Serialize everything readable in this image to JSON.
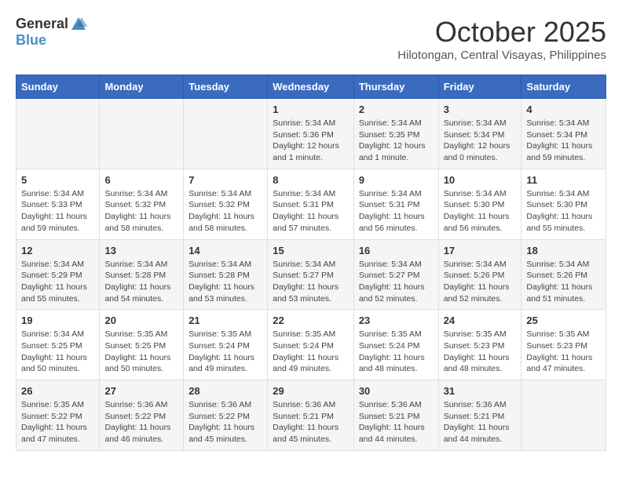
{
  "header": {
    "logo_general": "General",
    "logo_blue": "Blue",
    "month": "October 2025",
    "location": "Hilotongan, Central Visayas, Philippines"
  },
  "weekdays": [
    "Sunday",
    "Monday",
    "Tuesday",
    "Wednesday",
    "Thursday",
    "Friday",
    "Saturday"
  ],
  "weeks": [
    [
      {
        "day": "",
        "info": ""
      },
      {
        "day": "",
        "info": ""
      },
      {
        "day": "",
        "info": ""
      },
      {
        "day": "1",
        "info": "Sunrise: 5:34 AM\nSunset: 5:36 PM\nDaylight: 12 hours\nand 1 minute."
      },
      {
        "day": "2",
        "info": "Sunrise: 5:34 AM\nSunset: 5:35 PM\nDaylight: 12 hours\nand 1 minute."
      },
      {
        "day": "3",
        "info": "Sunrise: 5:34 AM\nSunset: 5:34 PM\nDaylight: 12 hours\nand 0 minutes."
      },
      {
        "day": "4",
        "info": "Sunrise: 5:34 AM\nSunset: 5:34 PM\nDaylight: 11 hours\nand 59 minutes."
      }
    ],
    [
      {
        "day": "5",
        "info": "Sunrise: 5:34 AM\nSunset: 5:33 PM\nDaylight: 11 hours\nand 59 minutes."
      },
      {
        "day": "6",
        "info": "Sunrise: 5:34 AM\nSunset: 5:32 PM\nDaylight: 11 hours\nand 58 minutes."
      },
      {
        "day": "7",
        "info": "Sunrise: 5:34 AM\nSunset: 5:32 PM\nDaylight: 11 hours\nand 58 minutes."
      },
      {
        "day": "8",
        "info": "Sunrise: 5:34 AM\nSunset: 5:31 PM\nDaylight: 11 hours\nand 57 minutes."
      },
      {
        "day": "9",
        "info": "Sunrise: 5:34 AM\nSunset: 5:31 PM\nDaylight: 11 hours\nand 56 minutes."
      },
      {
        "day": "10",
        "info": "Sunrise: 5:34 AM\nSunset: 5:30 PM\nDaylight: 11 hours\nand 56 minutes."
      },
      {
        "day": "11",
        "info": "Sunrise: 5:34 AM\nSunset: 5:30 PM\nDaylight: 11 hours\nand 55 minutes."
      }
    ],
    [
      {
        "day": "12",
        "info": "Sunrise: 5:34 AM\nSunset: 5:29 PM\nDaylight: 11 hours\nand 55 minutes."
      },
      {
        "day": "13",
        "info": "Sunrise: 5:34 AM\nSunset: 5:28 PM\nDaylight: 11 hours\nand 54 minutes."
      },
      {
        "day": "14",
        "info": "Sunrise: 5:34 AM\nSunset: 5:28 PM\nDaylight: 11 hours\nand 53 minutes."
      },
      {
        "day": "15",
        "info": "Sunrise: 5:34 AM\nSunset: 5:27 PM\nDaylight: 11 hours\nand 53 minutes."
      },
      {
        "day": "16",
        "info": "Sunrise: 5:34 AM\nSunset: 5:27 PM\nDaylight: 11 hours\nand 52 minutes."
      },
      {
        "day": "17",
        "info": "Sunrise: 5:34 AM\nSunset: 5:26 PM\nDaylight: 11 hours\nand 52 minutes."
      },
      {
        "day": "18",
        "info": "Sunrise: 5:34 AM\nSunset: 5:26 PM\nDaylight: 11 hours\nand 51 minutes."
      }
    ],
    [
      {
        "day": "19",
        "info": "Sunrise: 5:34 AM\nSunset: 5:25 PM\nDaylight: 11 hours\nand 50 minutes."
      },
      {
        "day": "20",
        "info": "Sunrise: 5:35 AM\nSunset: 5:25 PM\nDaylight: 11 hours\nand 50 minutes."
      },
      {
        "day": "21",
        "info": "Sunrise: 5:35 AM\nSunset: 5:24 PM\nDaylight: 11 hours\nand 49 minutes."
      },
      {
        "day": "22",
        "info": "Sunrise: 5:35 AM\nSunset: 5:24 PM\nDaylight: 11 hours\nand 49 minutes."
      },
      {
        "day": "23",
        "info": "Sunrise: 5:35 AM\nSunset: 5:24 PM\nDaylight: 11 hours\nand 48 minutes."
      },
      {
        "day": "24",
        "info": "Sunrise: 5:35 AM\nSunset: 5:23 PM\nDaylight: 11 hours\nand 48 minutes."
      },
      {
        "day": "25",
        "info": "Sunrise: 5:35 AM\nSunset: 5:23 PM\nDaylight: 11 hours\nand 47 minutes."
      }
    ],
    [
      {
        "day": "26",
        "info": "Sunrise: 5:35 AM\nSunset: 5:22 PM\nDaylight: 11 hours\nand 47 minutes."
      },
      {
        "day": "27",
        "info": "Sunrise: 5:36 AM\nSunset: 5:22 PM\nDaylight: 11 hours\nand 46 minutes."
      },
      {
        "day": "28",
        "info": "Sunrise: 5:36 AM\nSunset: 5:22 PM\nDaylight: 11 hours\nand 45 minutes."
      },
      {
        "day": "29",
        "info": "Sunrise: 5:36 AM\nSunset: 5:21 PM\nDaylight: 11 hours\nand 45 minutes."
      },
      {
        "day": "30",
        "info": "Sunrise: 5:36 AM\nSunset: 5:21 PM\nDaylight: 11 hours\nand 44 minutes."
      },
      {
        "day": "31",
        "info": "Sunrise: 5:36 AM\nSunset: 5:21 PM\nDaylight: 11 hours\nand 44 minutes."
      },
      {
        "day": "",
        "info": ""
      }
    ]
  ]
}
